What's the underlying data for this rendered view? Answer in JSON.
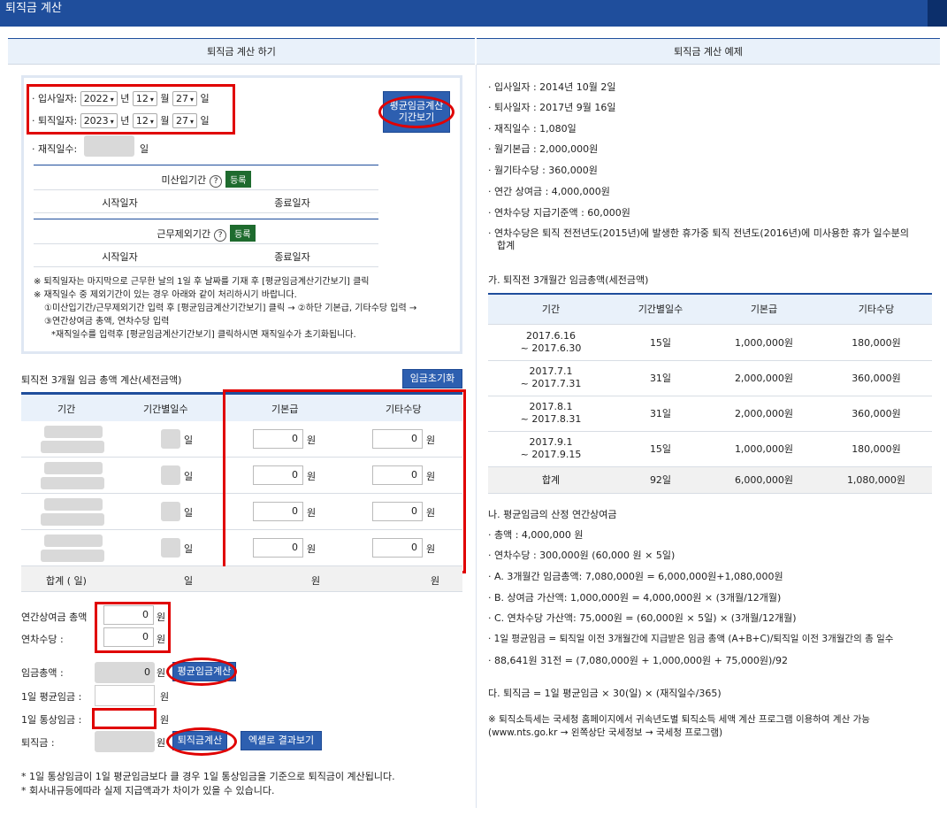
{
  "page_title": "퇴직금 계산",
  "left": {
    "header": "퇴직금 계산 하기",
    "join_label": "· 입사일자:",
    "leave_label": "· 퇴직일자:",
    "tenure_label": "· 재직일수:",
    "join": {
      "year": "2022",
      "month": "12",
      "day": "27"
    },
    "leave": {
      "year": "2023",
      "month": "12",
      "day": "27"
    },
    "unit_year": "년",
    "unit_month": "월",
    "unit_day": "일",
    "avg_period_btn": "평균임금계산\n기간보기",
    "unpaid_title": "미산입기간",
    "excluded_title": "근무제외기간",
    "register": "등록",
    "help": "?",
    "start_date": "시작일자",
    "end_date": "종료일자",
    "notes": [
      "※ 퇴직일자는 마지막으로 근무한 날의 1일 후 날짜를 기재 후 [평균임금계산기간보기] 클릭",
      "※ 재직일수 중 제외기간이 있는 경우 아래와 같이 처리하시기 바랍니다.",
      "①미산입기간/근무제외기간 입력 후 [평균임금계산기간보기] 클릭 → ②하단 기본급, 기타수당 입력 →",
      "③연간상여금 총액, 연차수당 입력",
      "*재직일수를 입력후 [평균임금계산기간보기] 클릭하시면 재직일수가 초기화됩니다."
    ],
    "wage_section_title": "퇴직전 3개월 임금 총액 계산(세전금액)",
    "wage_reset": "임금초기화",
    "wage_headers": [
      "기간",
      "기간별일수",
      "기본급",
      "기타수당"
    ],
    "wage_rows": [
      {
        "base": "0",
        "other": "0"
      },
      {
        "base": "0",
        "other": "0"
      },
      {
        "base": "0",
        "other": "0"
      },
      {
        "base": "0",
        "other": "0"
      }
    ],
    "won": "원",
    "il": "일",
    "total_row": {
      "label": "합계 (      일)",
      "days": "일",
      "base": "원",
      "other": "원"
    },
    "bonus_label": "연간상여금 총액",
    "bonus_value": "0",
    "leave_pay_label": "연차수당 :",
    "leave_pay_value": "0",
    "wage_total_label": "임금총액 :",
    "wage_total_value": "0",
    "avg_calc_btn": "평균임금계산",
    "daily_avg_label": "1일 평균임금 :",
    "daily_normal_label": "1일 통상임금 :",
    "severance_label": "퇴직금 :",
    "severance_btn": "퇴직금계산",
    "excel_btn": "엑셀로 결과보기",
    "footnotes": [
      "* 1일 통상임금이 1일 평균임금보다 클 경우 1일 통상임금을 기준으로 퇴직금이 계산됩니다.",
      "* 회사내규등에따라 실제 지급액과가 차이가 있을 수 있습니다."
    ]
  },
  "right": {
    "header": "퇴직금 계산 예제",
    "bullets": [
      "· 입사일자 : 2014년 10월 2일",
      "· 퇴사일자 : 2017년 9월 16일",
      "· 재직일수 : 1,080일",
      "· 월기본급 : 2,000,000원",
      "· 월기타수당 : 360,000원",
      "· 연간 상여금 : 4,000,000원",
      "· 연차수당 지급기준액 : 60,000원",
      "· 연차수당은 퇴직 전전년도(2015년)에 발생한 휴가중 퇴직 전년도(2016년)에 미사용한 휴가 일수분의",
      "합계"
    ],
    "section_a": "가. 퇴직전 3개월간 임금총액(세전금액)",
    "table_headers": [
      "기간",
      "기간별일수",
      "기본급",
      "기타수당"
    ],
    "table_rows": [
      {
        "period": "2017.6.16\n ~ 2017.6.30",
        "days": "15일",
        "base": "1,000,000원",
        "other": "180,000원"
      },
      {
        "period": "2017.7.1\n ~ 2017.7.31",
        "days": "31일",
        "base": "2,000,000원",
        "other": "360,000원"
      },
      {
        "period": "2017.8.1\n ~ 2017.8.31",
        "days": "31일",
        "base": "2,000,000원",
        "other": "360,000원"
      },
      {
        "period": "2017.9.1\n ~ 2017.9.15",
        "days": "15일",
        "base": "1,000,000원",
        "other": "180,000원"
      }
    ],
    "table_total": {
      "period": "합계",
      "days": "92일",
      "base": "6,000,000원",
      "other": "1,080,000원"
    },
    "section_b": "나. 평균임금의 산정 연간상여금",
    "b_lines": [
      "· 총액 : 4,000,000 원",
      "· 연차수당 : 300,000원 (60,000 원 × 5일)",
      "· A. 3개월간 임금총액: 7,080,000원 = 6,000,000원+1,080,000원",
      "· B. 상여금 가산액: 1,000,000원 = 4,000,000원 × (3개월/12개월)",
      "· C. 연차수당 가산액: 75,000원 = (60,000원 × 5일) × (3개월/12개월)",
      "· 1일 평균임금 = 퇴직일 이전 3개월간에 지급받은 임금 총액 (A+B+C)/퇴직일 이전 3개월간의 총 일수",
      "· 88,641원 31전 = (7,080,000원 + 1,000,000원 + 75,000원)/92"
    ],
    "section_c": "다. 퇴직금 = 1일 평균임금 × 30(일) × (재직일수/365)",
    "tax_note": [
      "※ 퇴직소득세는 국세청 홈페이지에서 귀속년도별 퇴직소득 세액 계산 프로그램 이용하여 계산 가능",
      "(www.nts.go.kr → 왼쪽상단 국세정보 → 국세청 프로그램)"
    ]
  }
}
